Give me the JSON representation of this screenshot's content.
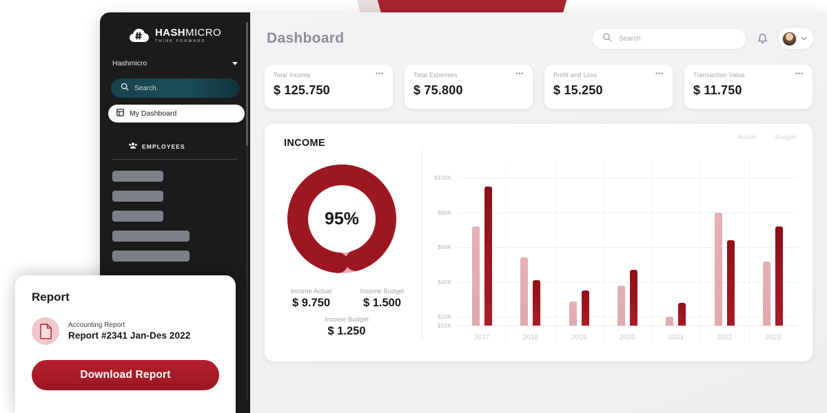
{
  "decor": {
    "accent_red": "#ab2430"
  },
  "sidebar": {
    "brand": {
      "name_bold": "HASH",
      "name_light": "MICRO",
      "tagline": "THINK FORWARD",
      "logo_icon": "cloud-hash-icon"
    },
    "org_switcher": {
      "name": "Hashmicro",
      "icon": "chevron-down-icon"
    },
    "search": {
      "placeholder": "Search.",
      "icon": "search-icon"
    },
    "active_item": {
      "label": "My Dashboard",
      "icon": "dashboard-grid-icon"
    },
    "section": {
      "label": "EMPLOYEES",
      "icon": "people-icon"
    },
    "skeleton_items": 5
  },
  "header": {
    "title": "Dashboard",
    "search": {
      "placeholder": "Search",
      "value": "",
      "icon": "search-icon"
    },
    "notification_icon": "bell-icon",
    "user": {
      "avatar": "user-avatar",
      "caret": "chevron-down-icon"
    }
  },
  "kpi_cards": [
    {
      "label": "Total Income",
      "value": "$ 125.750",
      "menu": "•••"
    },
    {
      "label": "Total Expenses",
      "value": "$ 75.800",
      "menu": "•••"
    },
    {
      "label": "Profit and Loss",
      "value": "$ 15.250",
      "menu": "•••"
    },
    {
      "label": "Transaction Value",
      "value": "$ 11.750",
      "menu": "•••"
    }
  ],
  "income_panel": {
    "title": "INCOME",
    "donut": {
      "percent_label": "95%",
      "percent_value": 95,
      "actual_color": "#9c1722",
      "remainder_color": "#e2b0b6"
    },
    "figures": [
      {
        "label": "Income Actual",
        "value": "$ 9.750"
      },
      {
        "label": "Income Budget",
        "value": "$ 1.500"
      }
    ],
    "figure_wide": {
      "label": "Income Budget",
      "value": "$ 1.250"
    }
  },
  "chart_data": {
    "type": "bar",
    "title": "",
    "xlabel": "",
    "ylabel": "",
    "categories": [
      "2017",
      "2018",
      "2019",
      "2020",
      "2021",
      "2022",
      "2023"
    ],
    "series": [
      {
        "name": "Actual",
        "color": "#e2b0b6",
        "values": [
          72,
          54,
          29,
          38,
          20,
          80,
          52
        ]
      },
      {
        "name": "Budget",
        "color": "#9c1722",
        "values": [
          95,
          41,
          35,
          47,
          28,
          64,
          72
        ]
      }
    ],
    "ytick_labels": [
      "$100K",
      "$80K",
      "$60K",
      "$40K",
      "$20K",
      "$15K"
    ],
    "ytick_values": [
      100,
      80,
      60,
      40,
      20,
      15
    ],
    "ylim": [
      15,
      108
    ],
    "unit": "K",
    "grid": true,
    "legend_position": "top-right"
  },
  "report_card": {
    "title": "Report",
    "icon": "document-icon",
    "subtitle": "Accounting Report",
    "name": "Report #2341 Jan-Des 2022",
    "button_label": "Download Report"
  }
}
